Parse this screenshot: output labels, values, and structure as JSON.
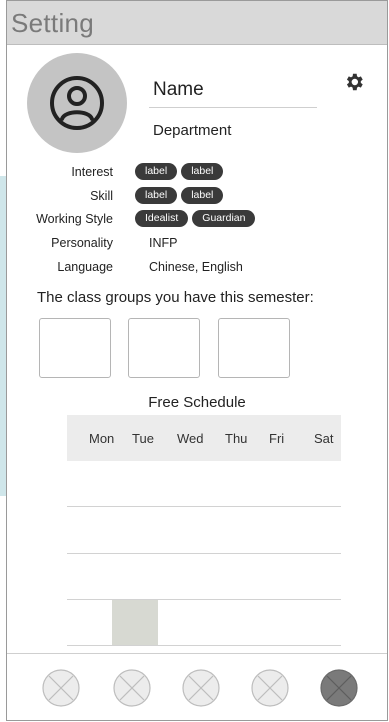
{
  "header": {
    "title": "Setting"
  },
  "profile": {
    "name": "Name",
    "department": "Department",
    "icons": {
      "avatar": "person-icon",
      "settings": "gear-icon"
    }
  },
  "attributes": {
    "interest": {
      "label": "Interest",
      "chips": [
        "label",
        "label"
      ]
    },
    "skill": {
      "label": "Skill",
      "chips": [
        "label",
        "label"
      ]
    },
    "working_style": {
      "label": "Working Style",
      "chips": [
        "Idealist",
        "Guardian"
      ]
    },
    "personality": {
      "label": "Personality",
      "value": "INFP"
    },
    "language": {
      "label": "Language",
      "value": "Chinese, English"
    }
  },
  "class_groups": {
    "title": "The class groups you have this semester:",
    "count": 3
  },
  "schedule": {
    "title": "Free Schedule",
    "days": [
      "Mon",
      "Tue",
      "Wed",
      "Thu",
      "Fri",
      "Sat"
    ]
  },
  "bottom_nav": {
    "items": [
      "placeholder-icon",
      "placeholder-icon",
      "placeholder-icon",
      "placeholder-icon",
      "placeholder-icon"
    ],
    "active_index": 4
  },
  "colors": {
    "header_bg": "#d9d9d9",
    "chip_bg": "#3a3a3a",
    "avatar_bg": "#c4c4c4",
    "filled_cell": "#d7d9d2",
    "accent_strip": "#cfe6ea"
  }
}
